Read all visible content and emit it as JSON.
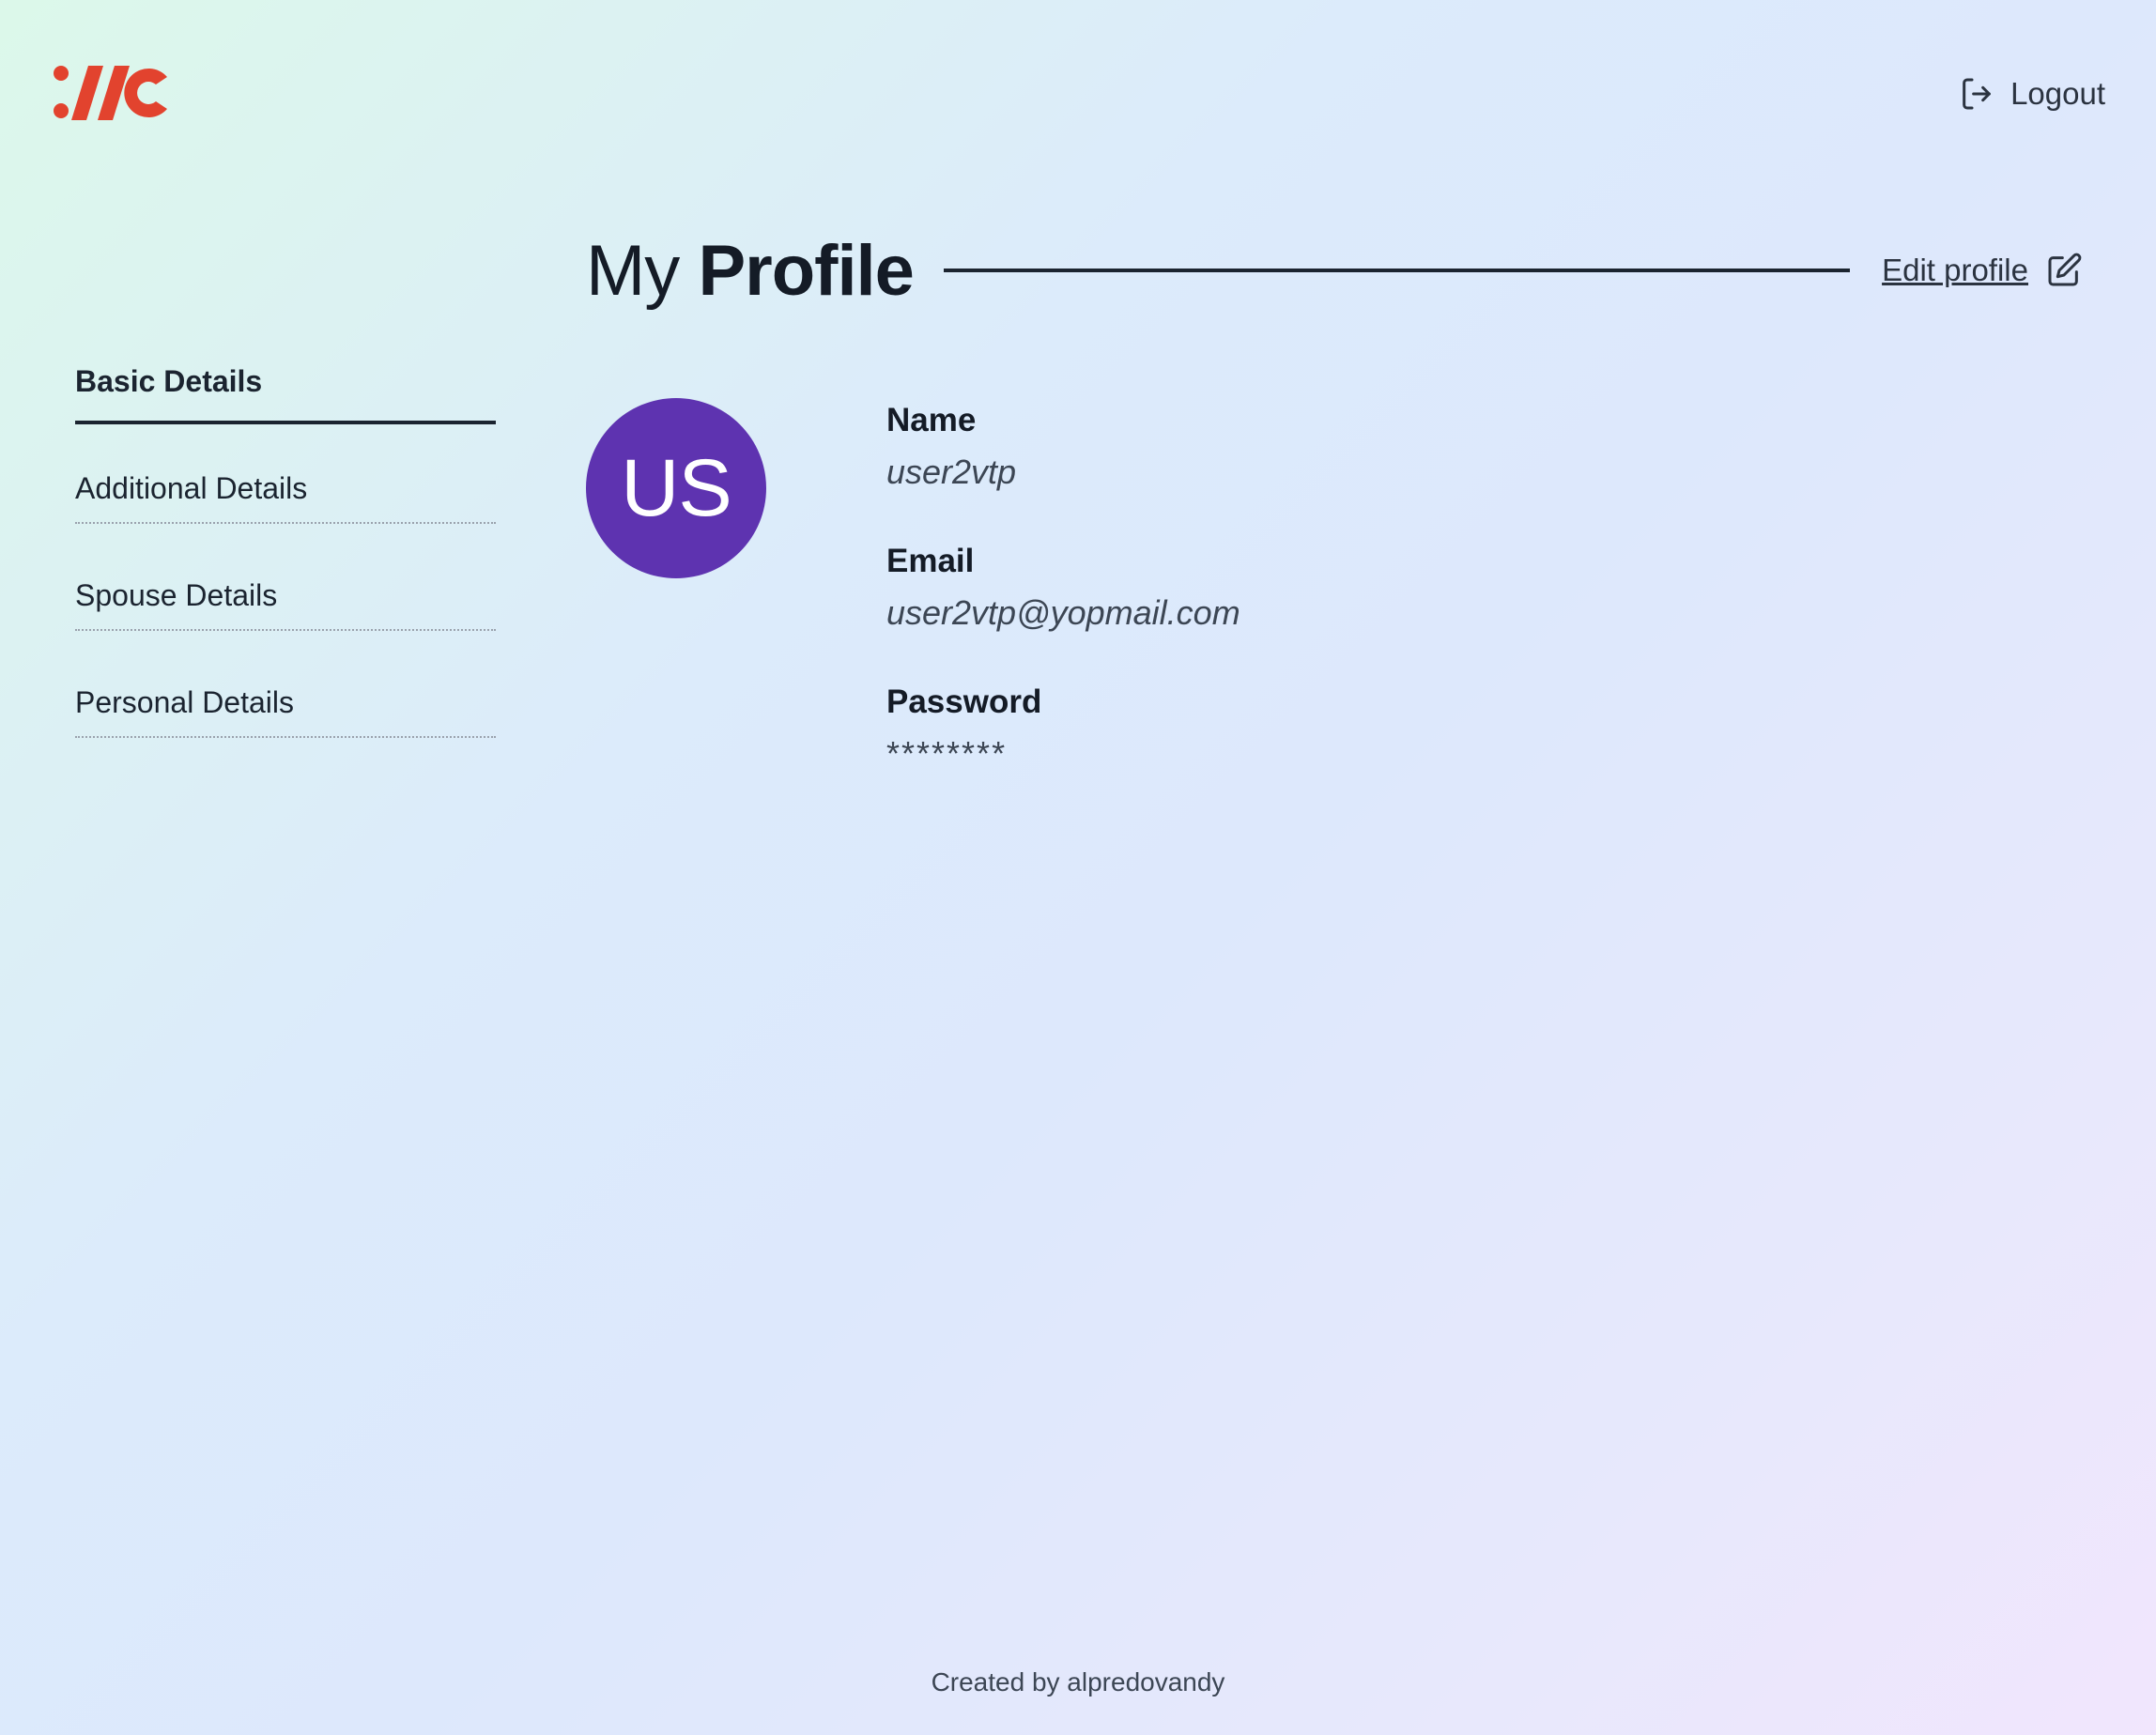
{
  "header": {
    "logo_icon": "company-logo",
    "brand_color": "#e2432e",
    "logout_label": "Logout",
    "logout_icon": "logout-icon"
  },
  "sidebar": {
    "items": [
      {
        "label": "Basic Details",
        "active": true
      },
      {
        "label": "Additional Details",
        "active": false
      },
      {
        "label": "Spouse Details",
        "active": false
      },
      {
        "label": "Personal Details",
        "active": false
      }
    ]
  },
  "profile": {
    "title_light": "My",
    "title_bold": "Profile",
    "edit_label": "Edit profile",
    "edit_icon": "edit-icon",
    "avatar_initials": "US",
    "avatar_color": "#5e33b0",
    "fields": [
      {
        "label": "Name",
        "value": "user2vtp"
      },
      {
        "label": "Email",
        "value": "user2vtp@yopmail.com"
      },
      {
        "label": "Password",
        "value": "********"
      }
    ]
  },
  "footer": {
    "text": "Created by alpredovandy"
  }
}
